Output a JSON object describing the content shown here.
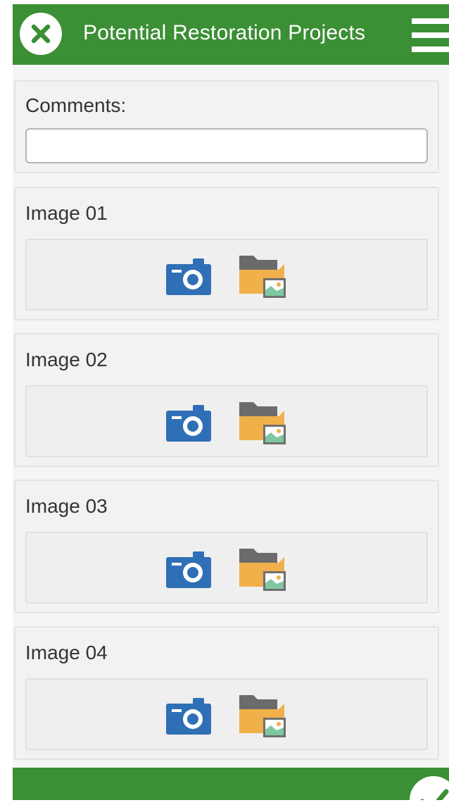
{
  "header": {
    "title": "Potential Restoration Projects",
    "close_icon": "close-x-icon",
    "menu_icon": "hamburger-menu-icon"
  },
  "comments": {
    "label": "Comments:",
    "value": "",
    "placeholder": ""
  },
  "images": [
    {
      "label": "Image 01",
      "camera_icon": "camera-icon",
      "gallery_icon": "folder-image-icon"
    },
    {
      "label": "Image 02",
      "camera_icon": "camera-icon",
      "gallery_icon": "folder-image-icon"
    },
    {
      "label": "Image 03",
      "camera_icon": "camera-icon",
      "gallery_icon": "folder-image-icon"
    },
    {
      "label": "Image 04",
      "camera_icon": "camera-icon",
      "gallery_icon": "folder-image-icon"
    }
  ],
  "footer": {
    "submit_icon": "checkmark-icon"
  },
  "colors": {
    "brand_green": "#3b8f34",
    "camera_blue": "#2f6fb5",
    "folder_orange": "#f0b04a",
    "folder_gray": "#6b6b6b"
  }
}
